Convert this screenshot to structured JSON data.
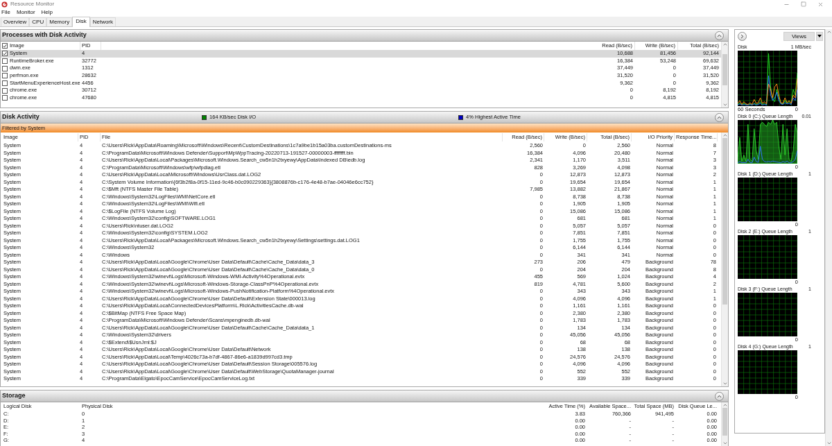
{
  "window": {
    "title": "Resource Monitor"
  },
  "menu": [
    "File",
    "Monitor",
    "Help"
  ],
  "tabs": [
    {
      "label": "Overview",
      "selected": false
    },
    {
      "label": "CPU",
      "selected": false
    },
    {
      "label": "Memory",
      "selected": false
    },
    {
      "label": "Disk",
      "selected": true
    },
    {
      "label": "Network",
      "selected": false
    }
  ],
  "processes": {
    "title": "Processes with Disk Activity",
    "all_checked": true,
    "columns": [
      "Image",
      "PID",
      "Read (B/sec)",
      "Write (B/sec)",
      "Total (B/sec)"
    ],
    "rows": [
      {
        "checked": true,
        "selected": true,
        "cells": [
          "System",
          "4",
          "10,688",
          "81,456",
          "92,144"
        ]
      },
      {
        "checked": false,
        "selected": false,
        "cells": [
          "RuntimeBroker.exe",
          "32772",
          "16,384",
          "53,248",
          "69,632"
        ]
      },
      {
        "checked": false,
        "selected": false,
        "cells": [
          "dwm.exe",
          "1312",
          "37,449",
          "0",
          "37,449"
        ]
      },
      {
        "checked": false,
        "selected": false,
        "cells": [
          "perfmon.exe",
          "28632",
          "31,520",
          "0",
          "31,520"
        ]
      },
      {
        "checked": false,
        "selected": false,
        "cells": [
          "StartMenuExperienceHost.exe",
          "4456",
          "9,362",
          "0",
          "9,362"
        ]
      },
      {
        "checked": false,
        "selected": false,
        "cells": [
          "chrome.exe",
          "30712",
          "0",
          "8,192",
          "8,192"
        ]
      },
      {
        "checked": false,
        "selected": false,
        "cells": [
          "chrome.exe",
          "47680",
          "0",
          "4,815",
          "4,815"
        ]
      }
    ]
  },
  "disk_activity": {
    "title": "Disk Activity",
    "indicators": [
      {
        "label": "164 KB/sec Disk I/O",
        "color": "#008000"
      },
      {
        "label": "4% Highest Active Time",
        "color": "#0000c0"
      }
    ],
    "filter": "Filtered by System",
    "columns": [
      "Image",
      "PID",
      "File",
      "Read (B/sec)",
      "Write (B/sec)",
      "Total (B/sec)",
      "I/O Priority",
      "Response Time..."
    ],
    "rows": [
      [
        "System",
        "4",
        "C:\\Users\\Rick\\AppData\\Roaming\\Microsoft\\Windows\\Recent\\CustomDestinations\\1c7a9be1b15a03ba.customDestinations-ms",
        "2,560",
        "0",
        "2,560",
        "Normal",
        "8"
      ],
      [
        "System",
        "4",
        "C:\\ProgramData\\Microsoft\\Windows Defender\\Support\\MpWppTracing-20220713-191527-00000003-ffffffff.bin",
        "16,384",
        "4,096",
        "20,480",
        "Normal",
        "7"
      ],
      [
        "System",
        "4",
        "C:\\Users\\Rick\\AppData\\Local\\Packages\\Microsoft.Windows.Search_cw5n1h2txyewy\\AppData\\Indexed DB\\edb.log",
        "2,341",
        "1,170",
        "3,511",
        "Normal",
        "3"
      ],
      [
        "System",
        "4",
        "C:\\ProgramData\\Microsoft\\Windows\\wfp\\wfpdiag.etl",
        "828",
        "3,269",
        "4,098",
        "Normal",
        "3"
      ],
      [
        "System",
        "4",
        "C:\\Users\\Rick\\AppData\\Local\\Microsoft\\Windows\\UsrClass.dat.LOG2",
        "0",
        "12,873",
        "12,873",
        "Normal",
        "2"
      ],
      [
        "System",
        "4",
        "C:\\System Volume Information\\{6f3b2f8a-0f15-11ed-9c46-b0c090229363}{3808876b-c176-4e48-b7ae-04046e6cc752}",
        "0",
        "19,654",
        "19,654",
        "Normal",
        "1"
      ],
      [
        "System",
        "4",
        "C:\\$Mft (NTFS Master File Table)",
        "7,985",
        "13,882",
        "21,867",
        "Normal",
        "1"
      ],
      [
        "System",
        "4",
        "C:\\Windows\\System32\\LogFiles\\WMI\\NetCore.etl",
        "0",
        "8,738",
        "8,738",
        "Normal",
        "1"
      ],
      [
        "System",
        "4",
        "C:\\Windows\\System32\\LogFiles\\WMI\\Wifi.etl",
        "0",
        "1,905",
        "1,905",
        "Normal",
        "1"
      ],
      [
        "System",
        "4",
        "C:\\$LogFile (NTFS Volume Log)",
        "0",
        "15,086",
        "15,086",
        "Normal",
        "1"
      ],
      [
        "System",
        "4",
        "C:\\Windows\\System32\\config\\SOFTWARE.LOG1",
        "0",
        "681",
        "681",
        "Normal",
        "1"
      ],
      [
        "System",
        "4",
        "C:\\Users\\Rick\\ntuser.dat.LOG2",
        "0",
        "5,057",
        "5,057",
        "Normal",
        "0"
      ],
      [
        "System",
        "4",
        "C:\\Windows\\System32\\config\\SYSTEM.LOG2",
        "0",
        "7,851",
        "7,851",
        "Normal",
        "0"
      ],
      [
        "System",
        "4",
        "C:\\Users\\Rick\\AppData\\Local\\Packages\\Microsoft.Windows.Search_cw5n1h2txyewy\\Settings\\settings.dat.LOG1",
        "0",
        "1,755",
        "1,755",
        "Normal",
        "0"
      ],
      [
        "System",
        "4",
        "C:\\Windows\\System32",
        "0",
        "6,144",
        "6,144",
        "Normal",
        "0"
      ],
      [
        "System",
        "4",
        "C:\\Windows",
        "0",
        "341",
        "341",
        "Normal",
        "0"
      ],
      [
        "System",
        "4",
        "C:\\Users\\Rick\\AppData\\Local\\Google\\Chrome\\User Data\\Default\\Cache\\Cache_Data\\data_3",
        "273",
        "206",
        "479",
        "Background",
        "78"
      ],
      [
        "System",
        "4",
        "C:\\Users\\Rick\\AppData\\Local\\Google\\Chrome\\User Data\\Default\\Cache\\Cache_Data\\data_0",
        "0",
        "204",
        "204",
        "Background",
        "8"
      ],
      [
        "System",
        "4",
        "C:\\Windows\\System32\\winevt\\Logs\\Microsoft-Windows-WMI-Activity%4Operational.evtx",
        "455",
        "569",
        "1,024",
        "Background",
        "4"
      ],
      [
        "System",
        "4",
        "C:\\Windows\\System32\\winevt\\Logs\\Microsoft-Windows-Storage-ClassPnP%4Operational.evtx",
        "819",
        "4,781",
        "5,600",
        "Background",
        "2"
      ],
      [
        "System",
        "4",
        "C:\\Windows\\System32\\winevt\\Logs\\Microsoft-Windows-PushNotification-Platform%4Operational.evtx",
        "0",
        "343",
        "343",
        "Background",
        "1"
      ],
      [
        "System",
        "4",
        "C:\\Users\\Rick\\AppData\\Local\\Google\\Chrome\\User Data\\Default\\Extension State\\000013.log",
        "0",
        "4,096",
        "4,096",
        "Background",
        "1"
      ],
      [
        "System",
        "4",
        "C:\\Users\\Rick\\AppData\\Local\\ConnectedDevicesPlatform\\L.Rick\\ActivitiesCache.db-wal",
        "0",
        "1,161",
        "1,161",
        "Background",
        "0"
      ],
      [
        "System",
        "4",
        "C:\\$BitMap (NTFS Free Space Map)",
        "0",
        "2,380",
        "2,380",
        "Background",
        "0"
      ],
      [
        "System",
        "4",
        "C:\\ProgramData\\Microsoft\\Windows Defender\\Scans\\mpenginedb.db-wal",
        "0",
        "1,783",
        "1,783",
        "Background",
        "0"
      ],
      [
        "System",
        "4",
        "C:\\Users\\Rick\\AppData\\Local\\Google\\Chrome\\User Data\\Default\\Cache\\Cache_Data\\data_1",
        "0",
        "134",
        "134",
        "Background",
        "0"
      ],
      [
        "System",
        "4",
        "C:\\Windows\\System32\\drivers",
        "0",
        "45,056",
        "45,056",
        "Background",
        "0"
      ],
      [
        "System",
        "4",
        "C:\\$Extend\\$UsnJrnl:$J",
        "0",
        "68",
        "68",
        "Background",
        "0"
      ],
      [
        "System",
        "4",
        "C:\\Users\\Rick\\AppData\\Local\\Google\\Chrome\\User Data\\Default\\Network",
        "0",
        "138",
        "138",
        "Background",
        "0"
      ],
      [
        "System",
        "4",
        "C:\\Users\\Rick\\AppData\\Local\\Temp\\4026c73a-b7df-4867-86e6-a1839d997cd3.tmp",
        "0",
        "24,576",
        "24,576",
        "Background",
        "0"
      ],
      [
        "System",
        "4",
        "C:\\Users\\Rick\\AppData\\Local\\Google\\Chrome\\User Data\\Default\\Session Storage\\005576.log",
        "0",
        "4,096",
        "4,096",
        "Background",
        "0"
      ],
      [
        "System",
        "4",
        "C:\\Users\\Rick\\AppData\\Local\\Google\\Chrome\\User Data\\Default\\WebStorage\\QuotaManager-journal",
        "0",
        "552",
        "552",
        "Background",
        "0"
      ],
      [
        "System",
        "4",
        "C:\\ProgramData\\Elgato\\EpocCamService\\EpocCamServiceLog.txt",
        "0",
        "339",
        "339",
        "Background",
        "0"
      ]
    ]
  },
  "storage": {
    "title": "Storage",
    "columns": [
      "Logical Disk",
      "Physical Disk",
      "Active Time (%)",
      "Available Space...",
      "Total Space (MB)",
      "Disk Queue Le..."
    ],
    "rows": [
      [
        "C:",
        "0",
        "3.83",
        "760,366",
        "941,495",
        "0.00"
      ],
      [
        "D:",
        "1",
        "0.00",
        "-",
        "-",
        "0.00"
      ],
      [
        "E:",
        "2",
        "0.00",
        "-",
        "-",
        "0.00"
      ],
      [
        "F:",
        "3",
        "0.00",
        "-",
        "-",
        "0.00"
      ],
      [
        "G:",
        "4",
        "0.00",
        "-",
        "-",
        "0.00"
      ]
    ]
  },
  "side_panel": {
    "views_button": "Views",
    "graphs": [
      {
        "kind": "throughput",
        "title": "Disk",
        "max": "1 MB/sec",
        "time_label": "60 Seconds",
        "min": "0"
      },
      {
        "kind": "queue_active",
        "title": "Disk 0 (C:) Queue Length",
        "max": "0.01",
        "min": "0"
      },
      {
        "kind": "queue_idle",
        "title": "Disk 1 (D:) Queue Length",
        "max": "1",
        "min": "0"
      },
      {
        "kind": "queue_idle",
        "title": "Disk 2 (E:) Queue Length",
        "max": "1",
        "min": "0"
      },
      {
        "kind": "queue_idle",
        "title": "Disk 3 (F:) Queue Length",
        "max": "1",
        "min": "0"
      },
      {
        "kind": "queue_idle",
        "title": "Disk 4 (G:) Queue Length",
        "max": "1",
        "min": "0"
      }
    ]
  }
}
